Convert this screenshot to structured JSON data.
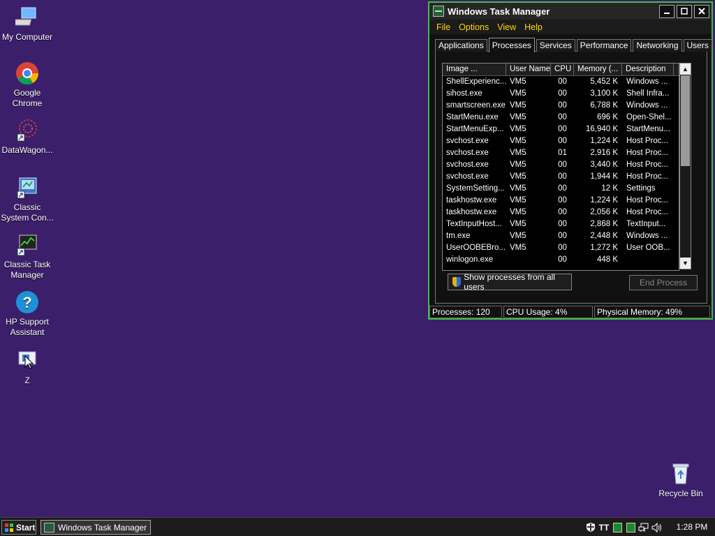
{
  "desktop": {
    "icons": [
      {
        "label": "My Computer",
        "icon": "computer-icon"
      },
      {
        "label": "Google Chrome",
        "icon": "chrome-icon"
      },
      {
        "label": "DataWagon...",
        "icon": "datawagon-icon"
      },
      {
        "label": "Classic System Con...",
        "icon": "control-panel-icon"
      },
      {
        "label": "Classic Task Manager",
        "icon": "task-manager-icon"
      },
      {
        "label": "HP Support Assistant",
        "icon": "help-icon"
      },
      {
        "label": "Z",
        "icon": "app-z-icon"
      },
      {
        "label": "Recycle Bin",
        "icon": "recycle-bin-icon"
      }
    ]
  },
  "window": {
    "title": "Windows Task Manager",
    "menu": [
      "File",
      "Options",
      "View",
      "Help"
    ],
    "tabs": [
      "Applications",
      "Processes",
      "Services",
      "Performance",
      "Networking",
      "Users"
    ],
    "active_tab": "Processes",
    "columns": [
      "Image ...",
      "User Name",
      "CPU",
      "Memory (...",
      "Description"
    ],
    "rows": [
      [
        "ShellExperienc...",
        "VM5",
        "00",
        "5,452 K",
        "Windows ..."
      ],
      [
        "sihost.exe",
        "VM5",
        "00",
        "3,100 K",
        "Shell Infra..."
      ],
      [
        "smartscreen.exe",
        "VM5",
        "00",
        "6,788 K",
        "Windows ..."
      ],
      [
        "StartMenu.exe",
        "VM5",
        "00",
        "696 K",
        "Open-Shel..."
      ],
      [
        "StartMenuExp...",
        "VM5",
        "00",
        "16,940 K",
        "StartMenu..."
      ],
      [
        "svchost.exe",
        "VM5",
        "00",
        "1,224 K",
        "Host Proc..."
      ],
      [
        "svchost.exe",
        "VM5",
        "01",
        "2,916 K",
        "Host Proc..."
      ],
      [
        "svchost.exe",
        "VM5",
        "00",
        "3,440 K",
        "Host Proc..."
      ],
      [
        "svchost.exe",
        "VM5",
        "00",
        "1,944 K",
        "Host Proc..."
      ],
      [
        "SystemSetting...",
        "VM5",
        "00",
        "12 K",
        "Settings"
      ],
      [
        "taskhostw.exe",
        "VM5",
        "00",
        "1,224 K",
        "Host Proc..."
      ],
      [
        "taskhostw.exe",
        "VM5",
        "00",
        "2,056 K",
        "Host Proc..."
      ],
      [
        "TextInputHost...",
        "VM5",
        "00",
        "2,868 K",
        "TextInput..."
      ],
      [
        "tm.exe",
        "VM5",
        "00",
        "2,448 K",
        "Windows ..."
      ],
      [
        "UserOOBEBro...",
        "VM5",
        "00",
        "1,272 K",
        "User OOB..."
      ],
      [
        "winlogon.exe",
        "",
        "00",
        "448 K",
        ""
      ]
    ],
    "show_all_label": "Show processes from all users",
    "end_process_label": "End Process",
    "status": {
      "processes": "Processes: 120",
      "cpu": "CPU Usage: 4%",
      "memory": "Physical Memory: 49%"
    }
  },
  "taskbar": {
    "start_label": "Start",
    "task_label": "Windows Task Manager",
    "clock": "1:28 PM",
    "tray_icons": [
      "security-shield-icon",
      "font-tt-icon",
      "green-app-icon",
      "green-app-icon",
      "network-icon",
      "volume-icon"
    ]
  },
  "colors": {
    "desktop_bg": "#3b1f6b",
    "window_border": "#3fbf3f",
    "menu_text": "#ffd700"
  }
}
